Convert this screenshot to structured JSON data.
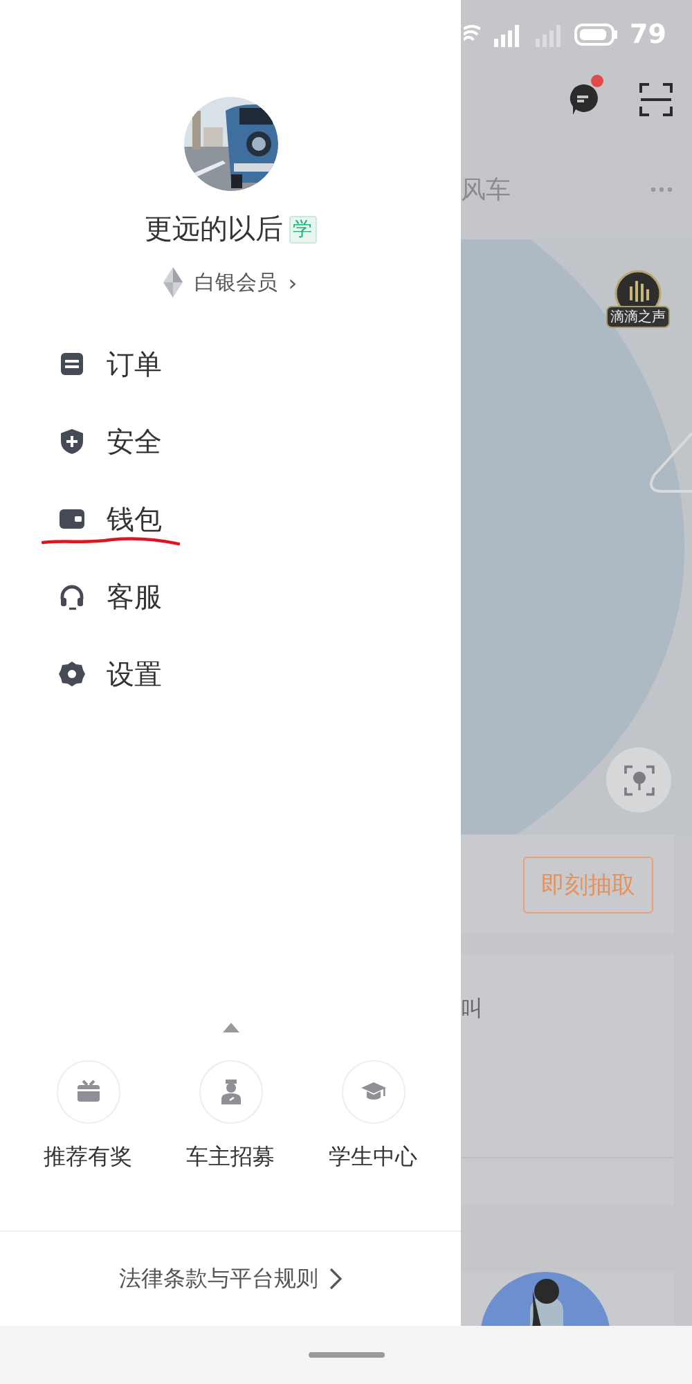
{
  "drawer": {
    "profile": {
      "name": "更远的以后",
      "badge": "学",
      "member": "白银会员",
      "chevron": "›"
    },
    "menu": [
      {
        "kind": "order",
        "label": "订单",
        "annotated": false
      },
      {
        "kind": "shield",
        "label": "安全",
        "annotated": false
      },
      {
        "kind": "wallet",
        "label": "钱包",
        "annotated": true
      },
      {
        "kind": "headset",
        "label": "客服",
        "annotated": false
      },
      {
        "kind": "gear",
        "label": "设置",
        "annotated": false
      }
    ],
    "shortcuts": [
      {
        "kind": "gift",
        "label": "推荐有奖"
      },
      {
        "kind": "driver",
        "label": "车主招募"
      },
      {
        "kind": "cap",
        "label": "学生中心"
      }
    ],
    "legal_link": "法律条款与平台规则"
  },
  "background_app": {
    "status_bar": {
      "battery": "79"
    },
    "tab": "风车",
    "voice_badge": "滴滴之声",
    "claim_button": "即刻抽取",
    "card_text": "叫"
  }
}
